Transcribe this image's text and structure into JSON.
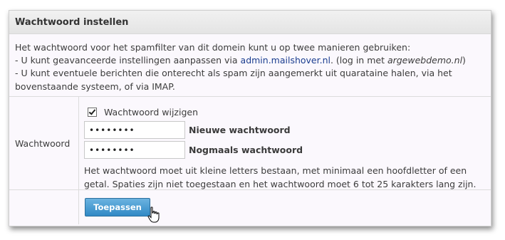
{
  "panel": {
    "title": "Wachtwoord instellen"
  },
  "intro": {
    "line1": "Het wachtwoord voor het spamfilter van dit domein kunt u op twee manieren gebruiken:",
    "line2_prefix": "- U kunt geavanceerde instellingen aanpassen via ",
    "line2_link": "admin.mailshover.nl",
    "line2_mid": ". (log in met ",
    "line2_login": "argewebdemo.nl",
    "line2_suffix": ")",
    "line3": "- U kunt eventuele berichten die onterecht als spam zijn aangemerkt uit quarataine halen, via het",
    "line4": "bovenstaande systeem, of via IMAP."
  },
  "password": {
    "row_label": "Wachtwoord",
    "change_checkbox_label": "Wachtwoord wijzigen",
    "change_checked": true,
    "new_value": "••••••••",
    "new_label": "Nieuwe wachtwoord",
    "repeat_value": "••••••••",
    "repeat_label": "Nogmaals wachtwoord",
    "hint_line1": "Het wachtwoord moet uit kleine letters bestaan, met minimaal een hoofdletter of een",
    "hint_line2": "getal. Spaties zijn niet toegestaan en het wachtwoord moet 6 tot 25 karakters lang zijn."
  },
  "actions": {
    "apply_label": "Toepassen"
  }
}
